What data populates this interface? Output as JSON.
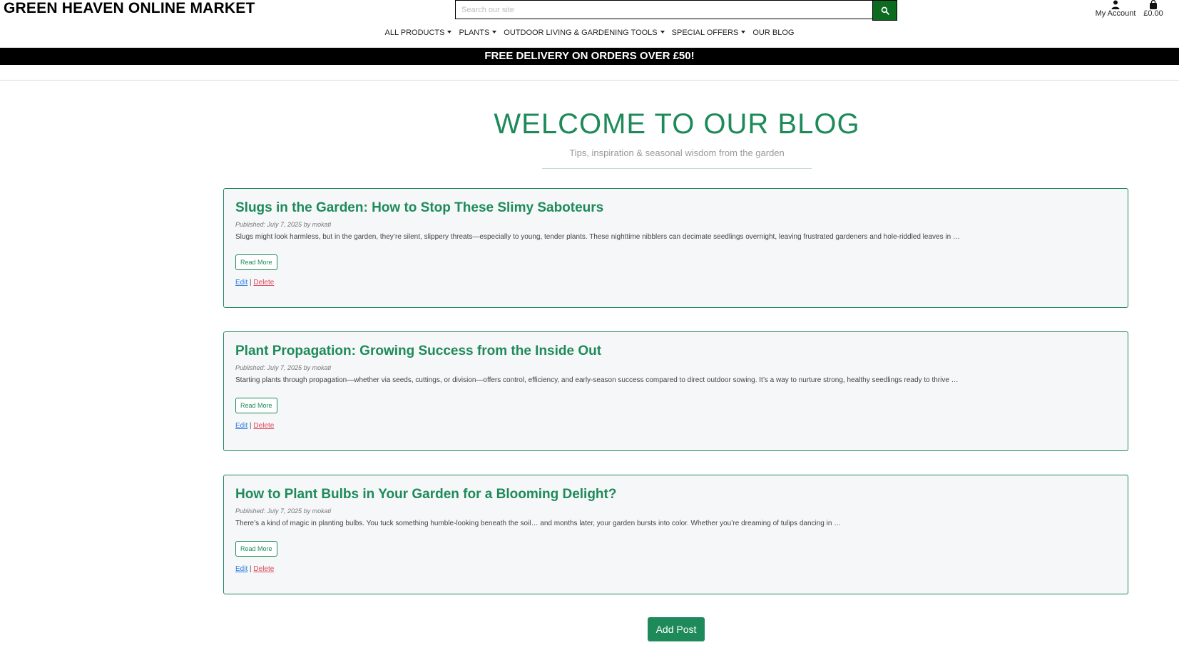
{
  "header": {
    "brand": "GREEN HEAVEN ONLINE MARKET",
    "search": {
      "placeholder": "Search our site",
      "icon": "search-icon"
    },
    "account": {
      "label": "My Account",
      "icon": "user-icon"
    },
    "bag": {
      "total": "£0.00",
      "icon": "shopping-bag-icon"
    }
  },
  "nav": {
    "items": [
      {
        "label": "ALL PRODUCTS",
        "dropdown": true
      },
      {
        "label": "PLANTS",
        "dropdown": true
      },
      {
        "label": "OUTDOOR LIVING & GARDENING TOOLS",
        "dropdown": true
      },
      {
        "label": "SPECIAL OFFERS",
        "dropdown": true
      },
      {
        "label": "OUR BLOG",
        "dropdown": false
      }
    ]
  },
  "banner": {
    "text": "FREE DELIVERY ON ORDERS OVER £50!"
  },
  "blog": {
    "title": "WELCOME TO OUR BLOG",
    "subtitle": "Tips, inspiration & seasonal wisdom from the garden",
    "posts": [
      {
        "title": "Slugs in the Garden: How to Stop These Slimy Saboteurs",
        "meta": "Published: July 7, 2025 by mokati",
        "excerpt": "Slugs might look harmless, but in the garden, they’re silent, slippery threats—especially to young, tender plants. These nighttime nibblers can decimate seedlings overnight, leaving frustrated gardeners and hole-riddled leaves in …",
        "read_more": "Read More",
        "edit": "Edit",
        "separator": "|",
        "delete": "Delete"
      },
      {
        "title": "Plant Propagation: Growing Success from the Inside Out",
        "meta": "Published: July 7, 2025 by mokati",
        "excerpt": "Starting plants through propagation—whether via seeds, cuttings, or division—offers control, efficiency, and early-season success compared to direct outdoor sowing. It’s a way to nurture strong, healthy seedlings ready to thrive …",
        "read_more": "Read More",
        "edit": "Edit",
        "separator": "|",
        "delete": "Delete"
      },
      {
        "title": "How to Plant Bulbs in Your Garden for a Blooming Delight?",
        "meta": "Published: July 7, 2025 by mokati",
        "excerpt": "There’s a kind of magic in planting bulbs. You tuck something humble-looking beneath the soil… and months later, your garden bursts into color. Whether you’re dreaming of tulips dancing in …",
        "read_more": "Read More",
        "edit": "Edit",
        "separator": "|",
        "delete": "Delete"
      }
    ],
    "add_post": "Add Post"
  },
  "colors": {
    "accent": "#1e8a5a",
    "search_button": "#0b6b1e",
    "banner_bg": "#000000",
    "edit_link": "#2a7ae2",
    "delete_link": "#e0475b"
  }
}
